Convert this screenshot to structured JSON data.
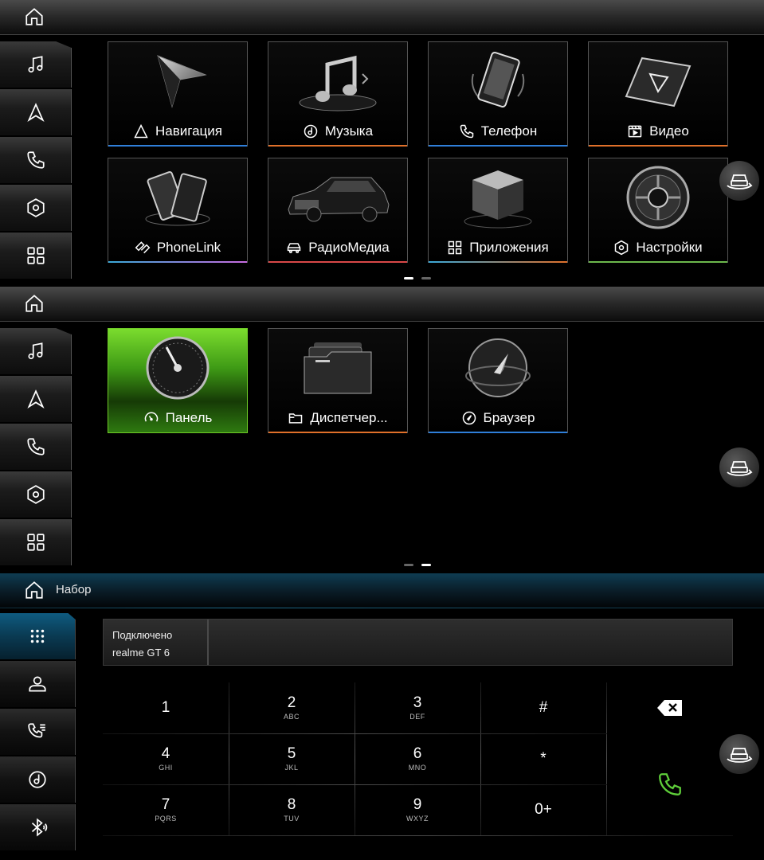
{
  "screen1": {
    "tiles": [
      {
        "label": "Навигация",
        "icon": "navigation-icon",
        "accent": "#2f7fd9"
      },
      {
        "label": "Музыка",
        "icon": "music-disc-icon",
        "accent": "#e0702a"
      },
      {
        "label": "Телефон",
        "icon": "phone-icon",
        "accent": "#2f7fd9"
      },
      {
        "label": "Видео",
        "icon": "video-icon",
        "accent": "#e0702a"
      },
      {
        "label": "PhoneLink",
        "icon": "phonelink-icon",
        "accent": "#9b7bd8"
      },
      {
        "label": "РадиоМедиа",
        "icon": "car-icon",
        "accent": "#d94848"
      },
      {
        "label": "Приложения",
        "icon": "apps-icon",
        "accent": "#3aa8d8"
      },
      {
        "label": "Настройки",
        "icon": "settings-icon",
        "accent": "#6cb84c"
      }
    ],
    "page_dots": [
      "active",
      "inactive"
    ]
  },
  "screen2": {
    "tiles": [
      {
        "label": "Панель",
        "icon": "speedometer-icon",
        "accent": "#7bdc2e"
      },
      {
        "label": "Диспетчер...",
        "icon": "folder-icon",
        "accent": "#e0702a"
      },
      {
        "label": "Браузер",
        "icon": "compass-icon",
        "accent": "#2f7fd9"
      }
    ],
    "page_dots": [
      "inactive",
      "active"
    ]
  },
  "screen3": {
    "title": "Набор",
    "status_line1": "Подключено",
    "status_line2": "realme GT 6",
    "keys": [
      {
        "d": "1",
        "s": ""
      },
      {
        "d": "2",
        "s": "ABC"
      },
      {
        "d": "3",
        "s": "DEF"
      },
      {
        "d": "#",
        "s": ""
      },
      {
        "d": "4",
        "s": "GHI"
      },
      {
        "d": "5",
        "s": "JKL"
      },
      {
        "d": "6",
        "s": "MNO"
      },
      {
        "d": "*",
        "s": ""
      },
      {
        "d": "7",
        "s": "PQRS"
      },
      {
        "d": "8",
        "s": "TUV"
      },
      {
        "d": "9",
        "s": "WXYZ"
      },
      {
        "d": "0+",
        "s": ""
      }
    ],
    "call_color": "#5fcf3a",
    "active_tab_color": "#1d8cc0"
  }
}
